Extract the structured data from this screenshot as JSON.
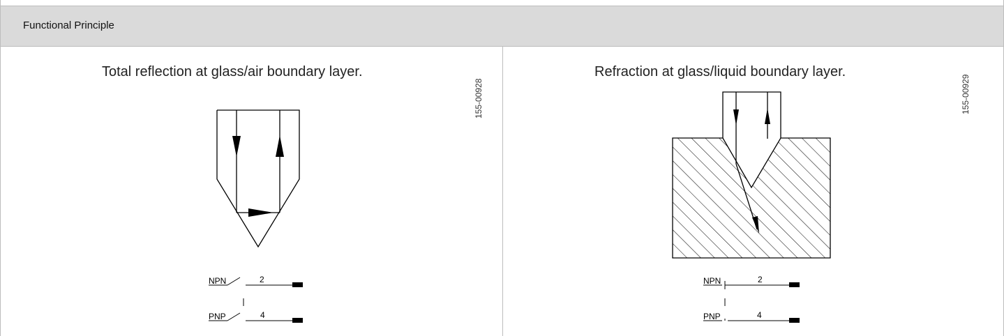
{
  "header": {
    "title": "Functional Principle"
  },
  "left_panel": {
    "caption": "Total reflection at glass/air boundary layer.",
    "code": "155-00928",
    "switch": {
      "top_label": "NPN",
      "top_pin": "2",
      "bottom_label": "PNP",
      "bottom_pin": "4"
    }
  },
  "right_panel": {
    "caption": "Refraction at glass/liquid boundary layer.",
    "code": "155-00929",
    "switch": {
      "top_label": "NPN",
      "top_pin": "2",
      "bottom_label": "PNP",
      "bottom_pin": "4"
    }
  }
}
